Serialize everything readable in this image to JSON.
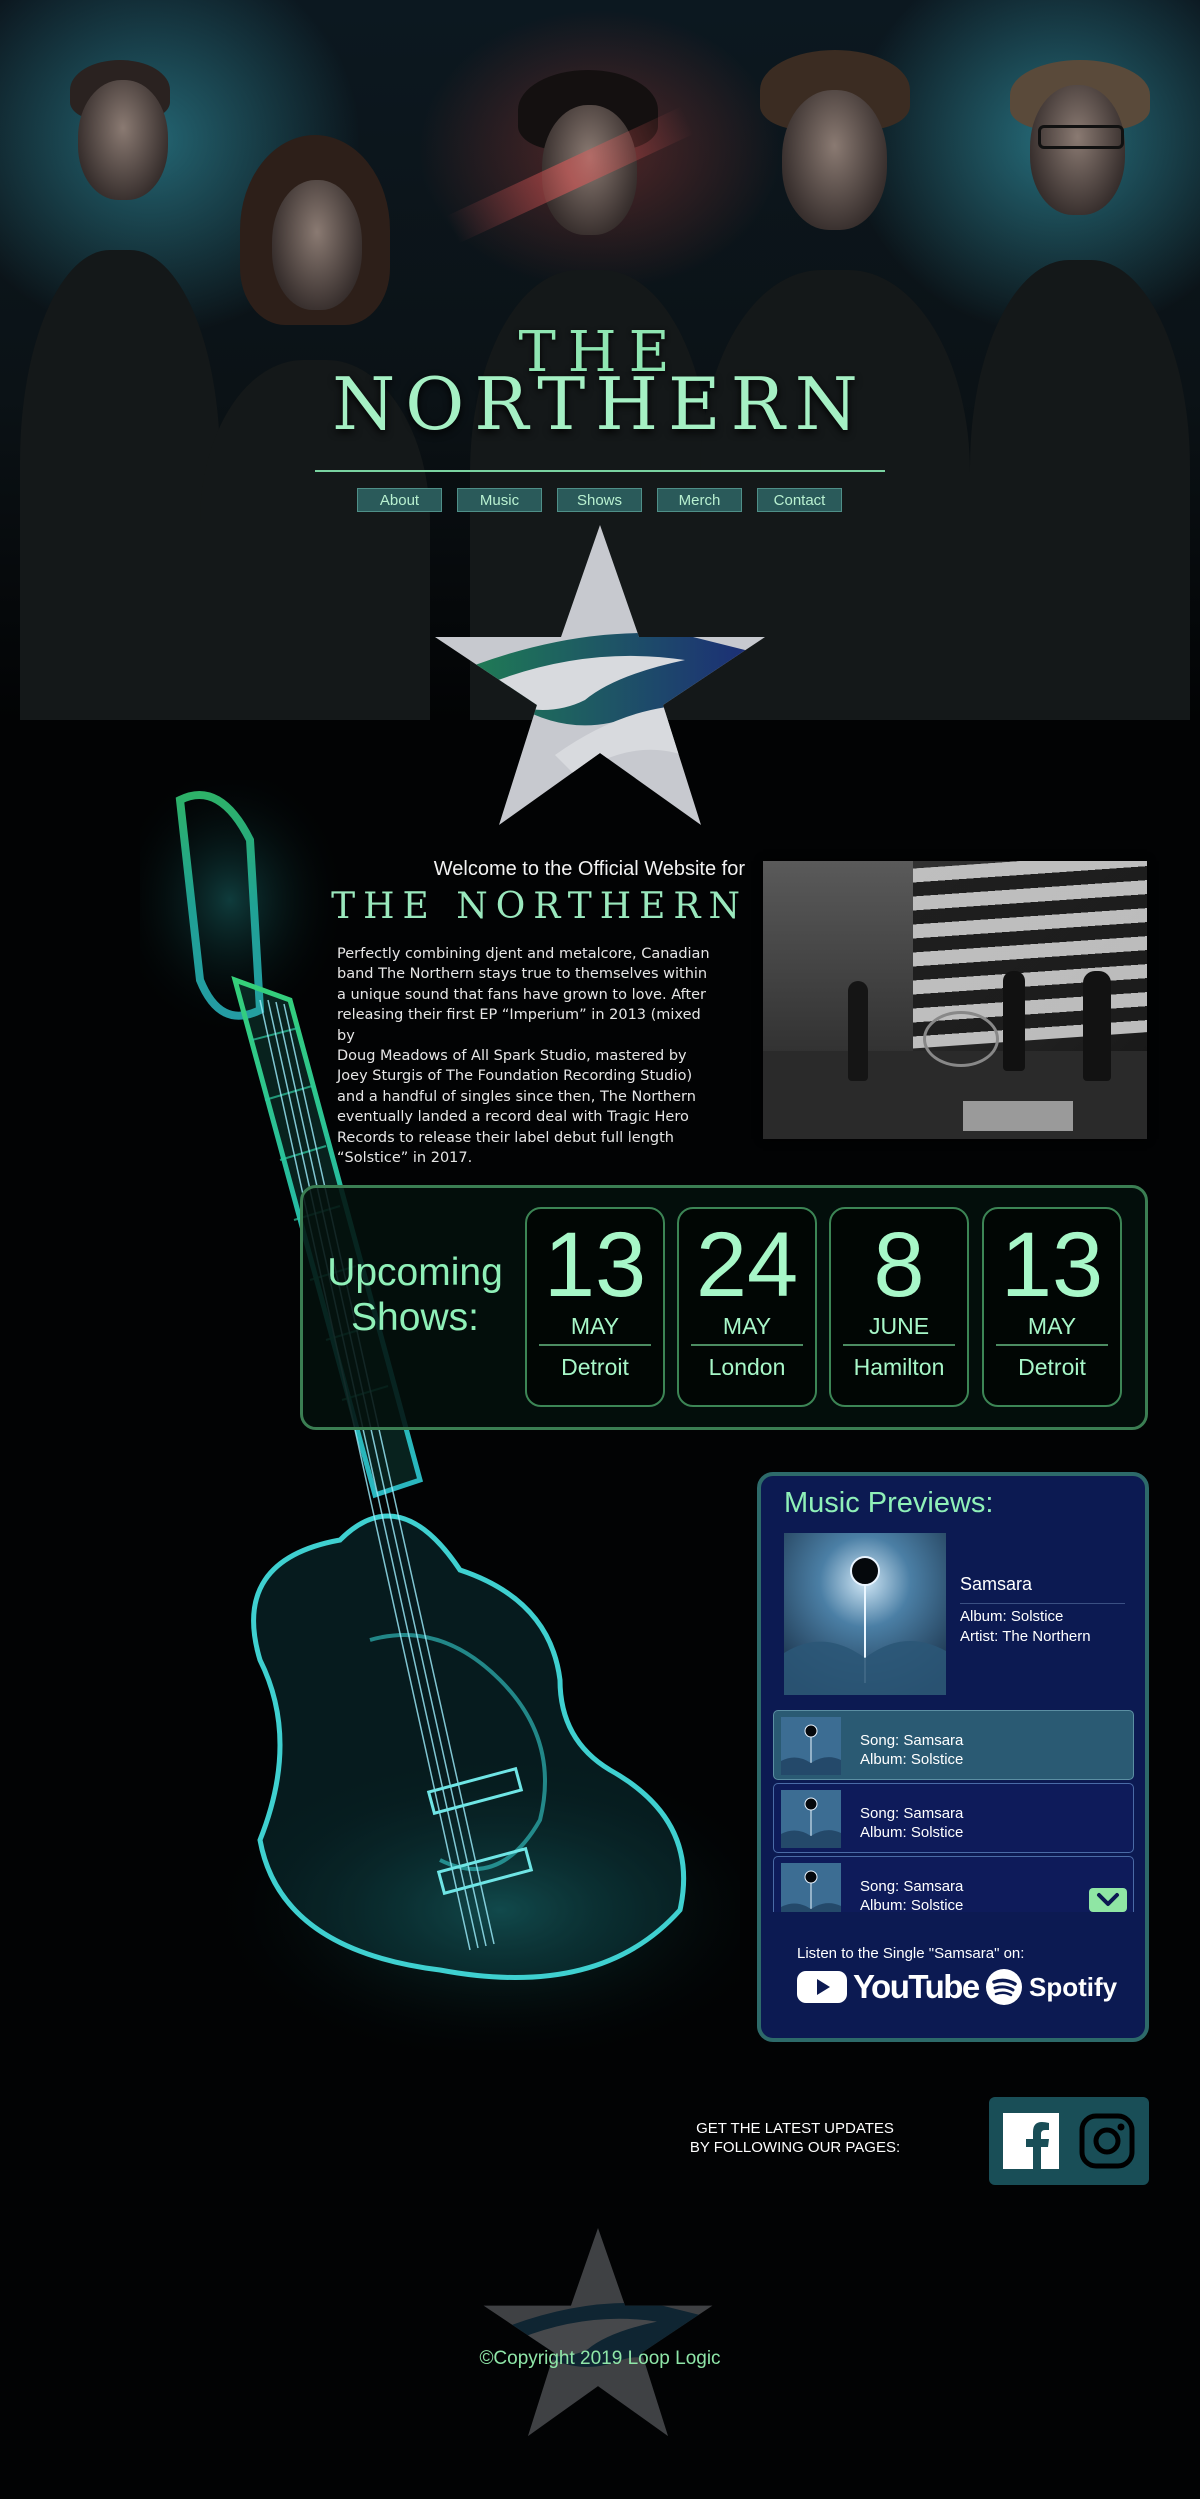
{
  "header": {
    "band_the": "THE",
    "band_name": "NORTHERN",
    "nav": [
      {
        "label": "About"
      },
      {
        "label": "Music"
      },
      {
        "label": "Shows"
      },
      {
        "label": "Merch"
      },
      {
        "label": "Contact"
      }
    ]
  },
  "welcome": {
    "intro": "Welcome to the Official Website for",
    "band": "THE NORTHERN",
    "bio_lines": [
      "Perfectly combining djent and metalcore, Canadian",
      "band The Northern stays true to themselves within",
      "a unique sound that fans have grown to love. After",
      "releasing their first EP “Imperium” in 2013 (mixed by",
      "Doug Meadows of All Spark Studio, mastered by",
      "Joey Sturgis of The Foundation Recording Studio)",
      "and a handful of singles since then, The Northern",
      "eventually landed a record deal with Tragic Hero",
      "Records to release their label debut full length",
      "“Solstice” in 2017."
    ]
  },
  "shows": {
    "title_line1": "Upcoming",
    "title_line2": "Shows:",
    "items": [
      {
        "day": "13",
        "month": "MAY",
        "city": "Detroit"
      },
      {
        "day": "24",
        "month": "MAY",
        "city": "London"
      },
      {
        "day": "8",
        "month": "JUNE",
        "city": "Hamilton"
      },
      {
        "day": "13",
        "month": "MAY",
        "city": "Detroit"
      }
    ]
  },
  "music": {
    "title": "Music Previews:",
    "featured": {
      "song": "Samsara",
      "album": "Album: Solstice",
      "artist": "Artist: The Northern"
    },
    "tracks": [
      {
        "song": "Song: Samsara",
        "album": "Album: Solstice"
      },
      {
        "song": "Song: Samsara",
        "album": "Album: Solstice"
      },
      {
        "song": "Song: Samsara",
        "album": "Album: Solstice"
      }
    ],
    "listen_text": "Listen to the Single \"Samsara\" on:",
    "youtube_label": "YouTube",
    "spotify_label": "Spotify"
  },
  "follow": {
    "line1": "GET THE LATEST UPDATES",
    "line2": "BY FOLLOWING OUR PAGES:",
    "icons": [
      "facebook-icon",
      "instagram-icon"
    ]
  },
  "footer": {
    "copyright": "©Copyright 2019 Loop Logic"
  },
  "colors": {
    "accent_green": "#8ff0b8",
    "panel_border": "#3b7e53",
    "music_panel_bg": "#0c1a52",
    "nav_bg": "#2a5a5a"
  }
}
